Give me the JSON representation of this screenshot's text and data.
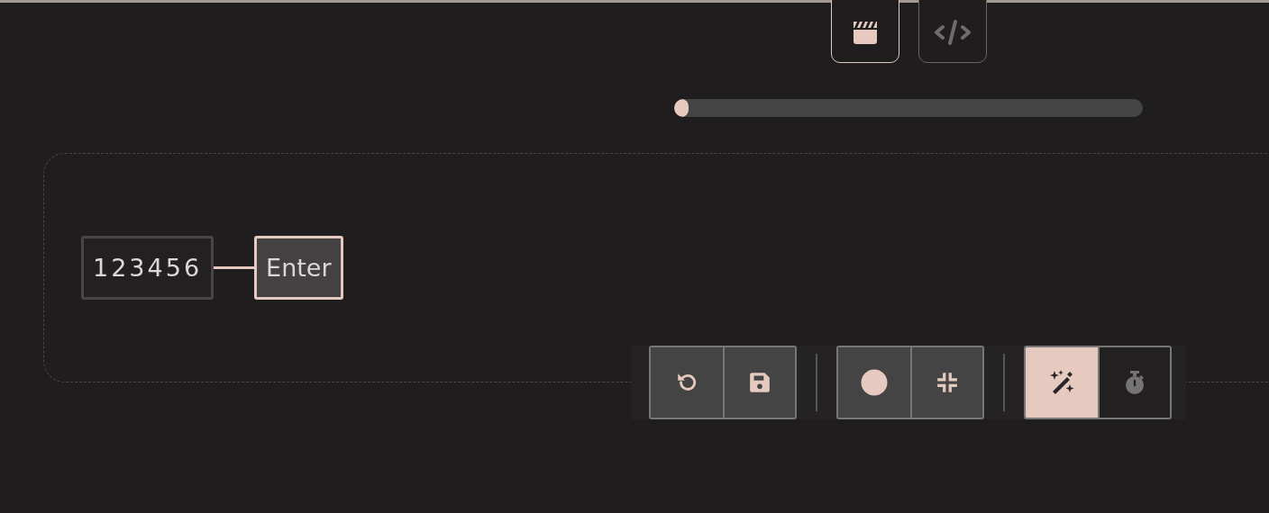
{
  "view_tabs": [
    {
      "kind": "video",
      "selected": true
    },
    {
      "kind": "code",
      "selected": false
    }
  ],
  "progress": {
    "level": 0.02
  },
  "sequence": [
    {
      "label": "123456",
      "selected": false
    },
    {
      "label": "Enter",
      "selected": true
    }
  ],
  "toolbar": {
    "groups": [
      [
        {
          "kind": "undo"
        },
        {
          "kind": "save"
        }
      ],
      [
        {
          "kind": "record"
        },
        {
          "kind": "collapse"
        }
      ],
      [
        {
          "kind": "magic",
          "selected": true
        },
        {
          "kind": "timer",
          "selected": false
        }
      ]
    ]
  }
}
